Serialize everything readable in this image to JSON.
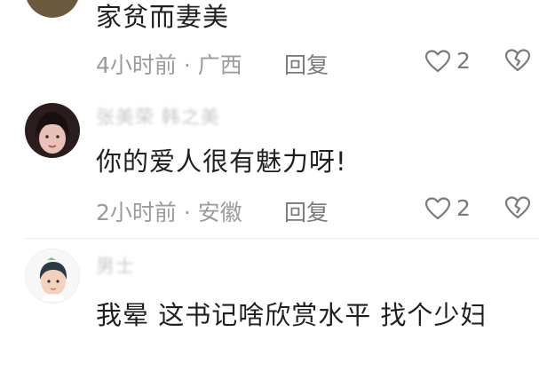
{
  "comments": [
    {
      "username": "",
      "content": "家贫而妻美",
      "time": "4小时前",
      "location": "广西",
      "reply_label": "回复",
      "likes": "2"
    },
    {
      "username": "张美荣 韩之美",
      "content": "你的爱人很有魅力呀!",
      "time": "2小时前",
      "location": "安徽",
      "reply_label": "回复",
      "likes": "2"
    },
    {
      "username": "男士",
      "content": "我晕  这书记啥欣赏水平  找个少妇"
    }
  ],
  "separator": " · ",
  "colors": {
    "text": "#1f1f1f",
    "meta": "#9b9b9b",
    "icon": "#7a7a7a"
  },
  "icons": [
    "heart-icon",
    "broken-heart-icon"
  ]
}
